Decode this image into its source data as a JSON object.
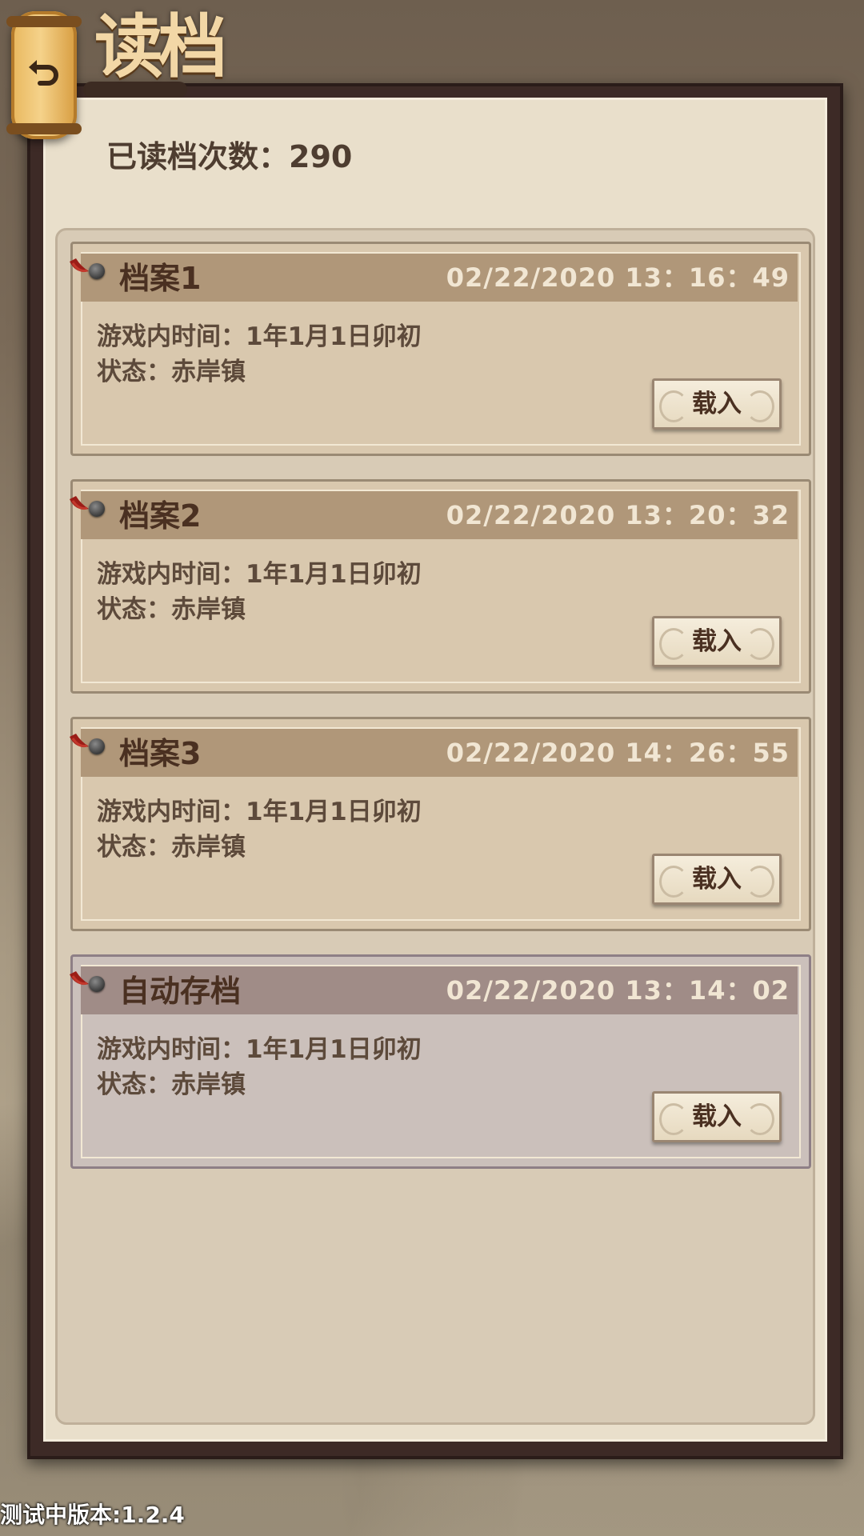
{
  "header": {
    "title": "读档",
    "back_icon": "back-arrow-icon"
  },
  "read_count": {
    "label": "已读档次数：290"
  },
  "saves": [
    {
      "name": "档案1",
      "datetime": "02/22/2020  13：16：49",
      "game_time": "游戏内时间：1年1月1日卯初",
      "status": "状态：赤岸镇",
      "load_label": "载入"
    },
    {
      "name": "档案2",
      "datetime": "02/22/2020  13：20：32",
      "game_time": "游戏内时间：1年1月1日卯初",
      "status": "状态：赤岸镇",
      "load_label": "载入"
    },
    {
      "name": "档案3",
      "datetime": "02/22/2020  14：26：55",
      "game_time": "游戏内时间：1年1月1日卯初",
      "status": "状态：赤岸镇",
      "load_label": "载入"
    },
    {
      "name": "自动存档",
      "datetime": "02/22/2020  13：14：02",
      "game_time": "游戏内时间：1年1月1日卯初",
      "status": "状态：赤岸镇",
      "load_label": "载入"
    }
  ],
  "footer": {
    "version": "测试中版本:1.2.4"
  },
  "colors": {
    "frame": "#3d2a26",
    "panel": "#e9dfcb",
    "card": "#d9c8ae",
    "card_auto": "#cbc0bb",
    "card_header": "#b09779",
    "text_dark": "#4a3021"
  }
}
